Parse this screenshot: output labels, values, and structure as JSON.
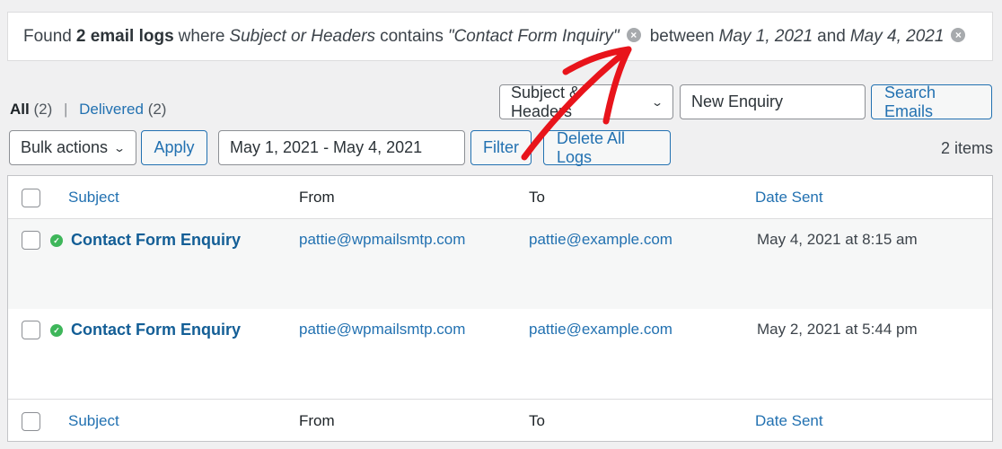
{
  "notice": {
    "prefix": "Found",
    "count_label": "2 email logs",
    "where": "where",
    "field": "Subject or Headers",
    "contains": "contains",
    "term": "\"Contact Form Inquiry\"",
    "between": "between",
    "date_from": "May 1, 2021",
    "and": "and",
    "date_to": "May 4, 2021",
    "clear_icon": "×"
  },
  "views": {
    "all_label": "All",
    "all_count": "(2)",
    "separator": "|",
    "delivered_label": "Delivered",
    "delivered_count": "(2)"
  },
  "search": {
    "field_select": "Subject & Headers",
    "query_value": "New Enquiry",
    "search_button": "Search Emails"
  },
  "toolbar": {
    "bulk_actions": "Bulk actions",
    "apply": "Apply",
    "date_range": "May 1, 2021 - May 4, 2021",
    "filter": "Filter",
    "delete_all": "Delete All Logs",
    "items_count": "2 items",
    "chevron": "⌄"
  },
  "table": {
    "columns": [
      "Subject",
      "From",
      "To",
      "Date Sent"
    ],
    "rows": [
      {
        "subject": "Contact Form Enquiry",
        "status": "delivered",
        "from": "pattie@wpmailsmtp.com",
        "to": "pattie@example.com",
        "date": "May 4, 2021 at 8:15 am"
      },
      {
        "subject": "Contact Form Enquiry",
        "status": "delivered",
        "from": "pattie@wpmailsmtp.com",
        "to": "pattie@example.com",
        "date": "May 2, 2021 at 5:44 pm"
      }
    ],
    "status_icon": "✓"
  },
  "annotation": {
    "type": "red-arrow",
    "color": "#e8141b",
    "points_to": "clear-search-term-icon"
  }
}
